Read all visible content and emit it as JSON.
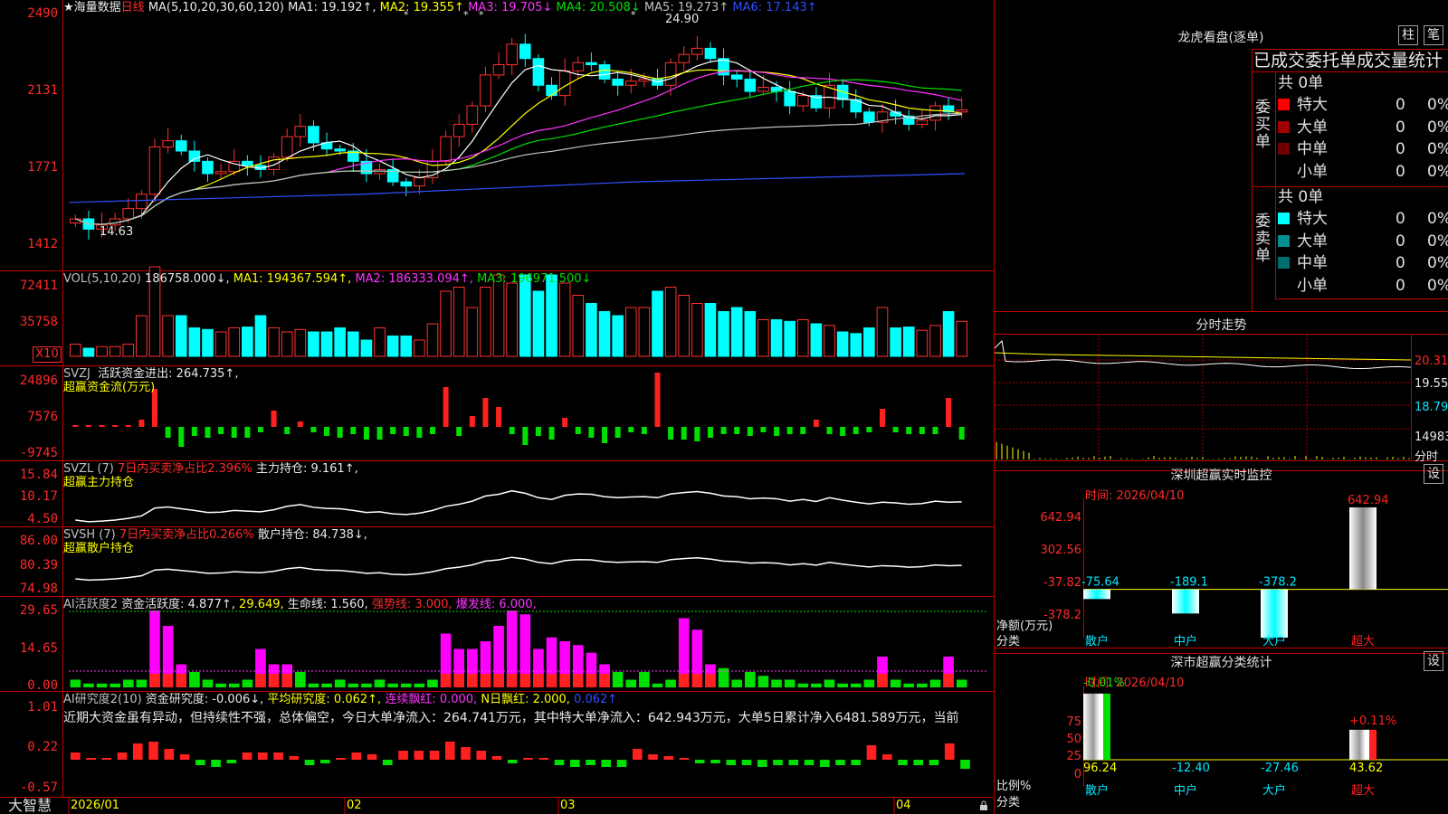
{
  "header": {
    "title": "★海量数据",
    "period": "日线",
    "ma_label": "MA(5,10,20,30,60,120)",
    "ma": [
      {
        "t": "MA1: 19.192↑,",
        "c": "c-w"
      },
      {
        "t": "MA2: 19.355↑",
        "c": "c-y"
      },
      {
        "t": "MA3: 19.705↓",
        "c": "c-m"
      },
      {
        "t": "MA4: 20.508↓",
        "c": "c-g"
      },
      {
        "t": "MA5: 19.273↑",
        "c": "c-t"
      },
      {
        "t": "MA6: 17.143↑",
        "c": "c-b"
      }
    ]
  },
  "price_axis": [
    "2490",
    "2131",
    "1771",
    "1412"
  ],
  "price_high": "24.90",
  "price_low": "14.63",
  "vol": {
    "label": "VOL(5,10,20)",
    "value": "186758.000↓,",
    "ma": [
      {
        "t": "MA1: 194367.594↑,",
        "c": "c-y"
      },
      {
        "t": "MA2: 186333.094↑,",
        "c": "c-m"
      },
      {
        "t": "MA3: 196971.500↓",
        "c": "c-g"
      }
    ],
    "axis": [
      "72411",
      "35758"
    ],
    "unit": "X10"
  },
  "svzj": {
    "label": "SVZJ",
    "name": "活跃资金进出: 264.735↑,",
    "sub": "超赢资金流(万元)",
    "axis": [
      "24896",
      "7576",
      "-9745"
    ]
  },
  "svzl": {
    "label": "SVZL (7)",
    "name": "7日内买卖净占比2.396%",
    "val": "主力持仓: 9.161↑,",
    "sub": "超赢主力持仓",
    "axis": [
      "15.84",
      "10.17",
      "4.50"
    ]
  },
  "svsh": {
    "label": "SVSH (7)",
    "name": "7日内买卖净占比0.266%",
    "val": "散户持仓: 84.738↓,",
    "sub": "超赢散户持仓",
    "axis": [
      "86.00",
      "80.39",
      "74.98"
    ]
  },
  "ai1": {
    "label": "AI活跃度2",
    "a": "资金活跃度: 4.877↑,",
    "b": "29.649,",
    "c": "生命线: 1.560,",
    "d": "强势线: 3.000,",
    "e": "爆发线: 6.000,",
    "axis": [
      "29.65",
      "14.65",
      "0.00"
    ]
  },
  "ai2": {
    "label": "AI研究度2(10)",
    "a": "资金研究度: -0.006↓,",
    "b": "平均研究度: 0.062↑,",
    "c": "连续飘红: 0.000,",
    "d": "N日飘红: 2.000,",
    "e": "0.062↑",
    "text": "近期大资金虽有异动，但持续性不强，总体偏空，今日大单净流入：264.741万元，其中特大单净流入：642.943万元，大单5日累计净入6481.589万元，当前",
    "axis": [
      "1.01",
      "0.22",
      "-0.57"
    ]
  },
  "date_axis": [
    "2026/01",
    "02",
    "03",
    "04"
  ],
  "brand": "大智慧",
  "lhkp": {
    "title": "龙虎看盘(逐单)",
    "btn1": "柱",
    "btn2": "笔",
    "sub": "已成交委托单成交量统计",
    "buy_label": "委买单",
    "sell_label": "委卖单",
    "buy_total": "共 0单",
    "sell_total": "共 0单",
    "buy_rows": [
      {
        "n": "特大",
        "v": "0",
        "p": "0%",
        "c": "#ff0000"
      },
      {
        "n": "大单",
        "v": "0",
        "p": "0%",
        "c": "#a00000"
      },
      {
        "n": "中单",
        "v": "0",
        "p": "0%",
        "c": "#700000"
      },
      {
        "n": "小单",
        "v": "0",
        "p": "0%",
        "c": ""
      }
    ],
    "sell_rows": [
      {
        "n": "特大",
        "v": "0",
        "p": "0%",
        "c": "#00ffff"
      },
      {
        "n": "大单",
        "v": "0",
        "p": "0%",
        "c": "#009090"
      },
      {
        "n": "中单",
        "v": "0",
        "p": "0%",
        "c": "#006f6f"
      },
      {
        "n": "小单",
        "v": "0",
        "p": "0%",
        "c": ""
      }
    ]
  },
  "fszs": {
    "title": "分时走势",
    "axis": [
      "20.31",
      "19.55",
      "18.79",
      "14983"
    ],
    "label": "分时"
  },
  "szjk": {
    "title": "深圳超赢实时监控",
    "btn": "设",
    "time": "时间: 2026/04/10",
    "axis": [
      "642.94",
      "302.56",
      "-37.82",
      "-378.2"
    ],
    "ylabel": "净额(万元)",
    "xlabel": "分类",
    "cats": [
      "散户",
      "中户",
      "大户",
      "超大"
    ],
    "chart_data": {
      "type": "bar",
      "categories": [
        "散户",
        "中户",
        "大户",
        "超大"
      ],
      "values": [
        -75.64,
        -189.1,
        -378.2,
        642.94
      ],
      "ylim": [
        -378.2,
        642.94
      ],
      "ylabel": "净额(万元)",
      "xlabel": "分类"
    },
    "labels": [
      "-75.64",
      "-189.1",
      "-378.2",
      "642.94"
    ]
  },
  "sclt": {
    "title": "深市超赢分类统计",
    "btn": "设",
    "time": "时间: 2026/04/10",
    "axis": [
      "75",
      "50",
      "25",
      "0"
    ],
    "ylabel": "比例%",
    "xlabel": "分类",
    "cats": [
      "散户",
      "中户",
      "大户",
      "超大"
    ],
    "top_labels": [
      "-0.01%",
      "+0.11%"
    ],
    "vals": [
      "96.24",
      "-12.40",
      "-27.46",
      "43.62"
    ],
    "chart_data": {
      "type": "bar",
      "categories": [
        "散户",
        "中户",
        "大户",
        "超大"
      ],
      "values": [
        96.24,
        -12.4,
        -27.46,
        43.62
      ],
      "ylabel": "比例%",
      "xlabel": "分类"
    }
  }
}
